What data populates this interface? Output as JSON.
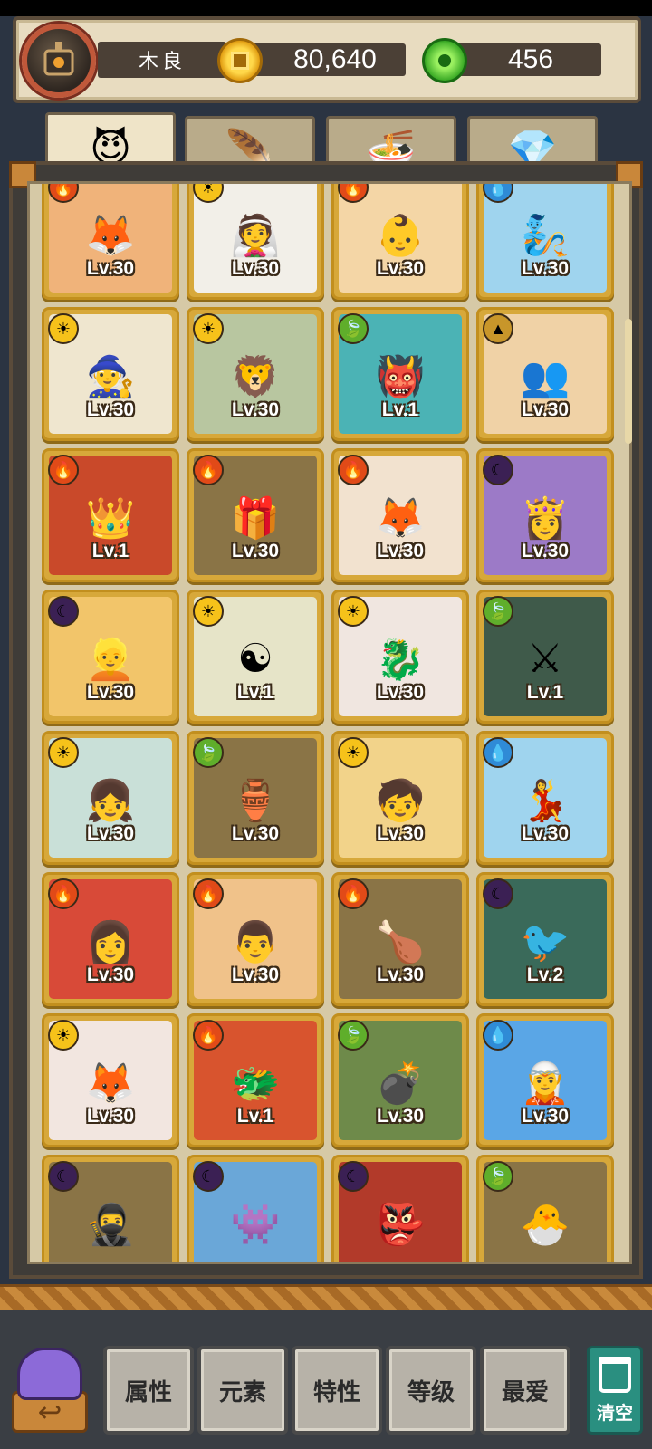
{
  "player": {
    "name": "木良",
    "gold": "80,640",
    "gems": "456"
  },
  "tabs": [
    {
      "name": "tab-monsters",
      "icon": "😈"
    },
    {
      "name": "tab-items",
      "icon": "🪶"
    },
    {
      "name": "tab-food",
      "icon": "🍜"
    },
    {
      "name": "tab-crystals",
      "icon": "💎"
    }
  ],
  "heroes": [
    {
      "level": "Lv.30",
      "element": "fire",
      "icon": "🦊",
      "bg": "#f0b37a"
    },
    {
      "level": "Lv.30",
      "element": "light",
      "icon": "👰",
      "bg": "#f2efe8"
    },
    {
      "level": "Lv.30",
      "element": "fire",
      "icon": "👶",
      "bg": "#f4d6a6"
    },
    {
      "level": "Lv.30",
      "element": "water",
      "icon": "🧞",
      "bg": "#9fd4ee"
    },
    {
      "level": "Lv.30",
      "element": "light",
      "icon": "🧙",
      "bg": "#efe6cf"
    },
    {
      "level": "Lv.30",
      "element": "light",
      "icon": "🦁",
      "bg": "#b8c6a0"
    },
    {
      "level": "Lv.1",
      "element": "nature",
      "icon": "👹",
      "bg": "#4bb3b5"
    },
    {
      "level": "Lv.30",
      "element": "earth",
      "icon": "👥",
      "bg": "#f0d2a6"
    },
    {
      "level": "Lv.1",
      "element": "fire",
      "icon": "👑",
      "bg": "#c9492a"
    },
    {
      "level": "Lv.30",
      "element": "fire",
      "icon": "🎁",
      "bg": "#8a7446"
    },
    {
      "level": "Lv.30",
      "element": "fire",
      "icon": "🦊",
      "bg": "#f2e2cf"
    },
    {
      "level": "Lv.30",
      "element": "dark",
      "icon": "👸",
      "bg": "#9c7ac7"
    },
    {
      "level": "Lv.30",
      "element": "dark",
      "icon": "👱",
      "bg": "#f2c56a"
    },
    {
      "level": "Lv.1",
      "element": "light",
      "icon": "☯",
      "bg": "#e6e4c8"
    },
    {
      "level": "Lv.30",
      "element": "light",
      "icon": "🐉",
      "bg": "#f0e6e0"
    },
    {
      "level": "Lv.1",
      "element": "nature",
      "icon": "⚔",
      "bg": "#3f5a4a"
    },
    {
      "level": "Lv.30",
      "element": "light",
      "icon": "👧",
      "bg": "#c9e0d8"
    },
    {
      "level": "Lv.30",
      "element": "nature",
      "icon": "🏺",
      "bg": "#8a7446"
    },
    {
      "level": "Lv.30",
      "element": "light",
      "icon": "🧒",
      "bg": "#f2d38a"
    },
    {
      "level": "Lv.30",
      "element": "water",
      "icon": "💃",
      "bg": "#9fd4ee"
    },
    {
      "level": "Lv.30",
      "element": "fire",
      "icon": "👩",
      "bg": "#d84a38"
    },
    {
      "level": "Lv.30",
      "element": "fire",
      "icon": "👨",
      "bg": "#f0c28a"
    },
    {
      "level": "Lv.30",
      "element": "fire",
      "icon": "🍗",
      "bg": "#8a7446"
    },
    {
      "level": "Lv.2",
      "element": "dark",
      "icon": "🐦",
      "bg": "#3a6a5a"
    },
    {
      "level": "Lv.30",
      "element": "light",
      "icon": "🦊",
      "bg": "#f2e6e0"
    },
    {
      "level": "Lv.1",
      "element": "fire",
      "icon": "🐲",
      "bg": "#d8542e"
    },
    {
      "level": "Lv.30",
      "element": "nature",
      "icon": "💣",
      "bg": "#6e8a4a"
    },
    {
      "level": "Lv.30",
      "element": "water",
      "icon": "🧝",
      "bg": "#5aa6e6"
    },
    {
      "level": "",
      "element": "dark",
      "icon": "🥷",
      "bg": "#8a7446"
    },
    {
      "level": "",
      "element": "dark",
      "icon": "👾",
      "bg": "#6aa7d8"
    },
    {
      "level": "",
      "element": "dark",
      "icon": "👺",
      "bg": "#b23a2a"
    },
    {
      "level": "",
      "element": "nature",
      "icon": "🐣",
      "bg": "#8a7446"
    }
  ],
  "filters": [
    "属性",
    "元素",
    "特性",
    "等级",
    "最爱"
  ],
  "clear_label": "清空",
  "back_icon": "↩"
}
